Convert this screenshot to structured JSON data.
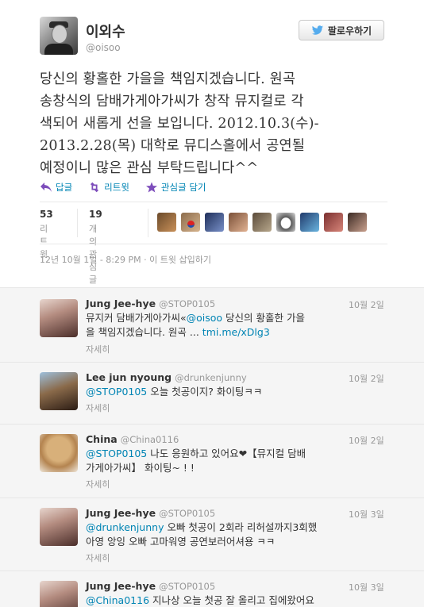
{
  "main_tweet": {
    "display_name": "이외수",
    "screen_name": "@oisoo",
    "follow_label": "팔로우하기",
    "text_lines": [
      "당신의 황홀한 가을을 책임지겠습니다. 원곡",
      "송창식의 담배가게아가씨가 창작 뮤지컬로 각",
      "색되어 새롭게 선을 보입니다. 2012.10.3(수)-",
      "2013.2.28(목) 대학로 뮤디스홀에서 공연될",
      "예정이니 많은 관심 부탁드립니다^^"
    ],
    "actions": {
      "reply": "답글",
      "retweet": "리트윗",
      "favorite": "관심글 담기"
    },
    "stats": {
      "retweets_count": "53",
      "retweets_label": "리트윗",
      "favorites_count": "19",
      "favorites_label": "개의 관심글"
    },
    "timestamp": "12년 10월 1일 - 8:29 PM · 이 트윗 삽입하기"
  },
  "replies": [
    {
      "name": "Jung Jee-hye",
      "handle": "@STOP0105",
      "date": "10월 2일",
      "line1_pre": "뮤지커 담배가게아가씨«",
      "line1_mention": "@oisoo",
      "line1_post": " 당신의 황홀한 가을",
      "line2_pre": "을 책임지겠습니다. 원곡 ... ",
      "line2_link": "tmi.me/xDlg3",
      "more": "자세히"
    },
    {
      "name": "Lee jun nyoung",
      "handle": "@drunkenjunny",
      "date": "10월 2일",
      "line1_mention": "@STOP0105",
      "line1_post": " 오늘 첫공이지? 화이팅ㅋㅋ",
      "more": "자세히"
    },
    {
      "name": "China",
      "handle": "@China0116",
      "date": "10월 2일",
      "line1_mention": "@STOP0105",
      "line1_post": " 나도 응원하고 있어요❤【뮤지컬 담배",
      "line2": "가게아가씨】   화이팅~ ! !",
      "more": "자세히"
    },
    {
      "name": "Jung Jee-hye",
      "handle": "@STOP0105",
      "date": "10월 3일",
      "line1_mention": "@drunkenjunny",
      "line1_post": " 오빠 첫공이 2회라 리허설까지3회했",
      "line2": "아영 앙잉 오빠 고마워영 공연보러어셔용 ㅋㅋ",
      "more": "자세히"
    },
    {
      "name": "Jung Jee-hye",
      "handle": "@STOP0105",
      "date": "10월 3일",
      "line1_mention": "@China0116",
      "line1_post": " 지나상 오늘 첫공 잘 올리고 집에왔어요"
    }
  ],
  "colors": {
    "link": "#0084b4",
    "muted": "#999999",
    "text": "#333333",
    "reply_bg": "#f5f5f5"
  }
}
